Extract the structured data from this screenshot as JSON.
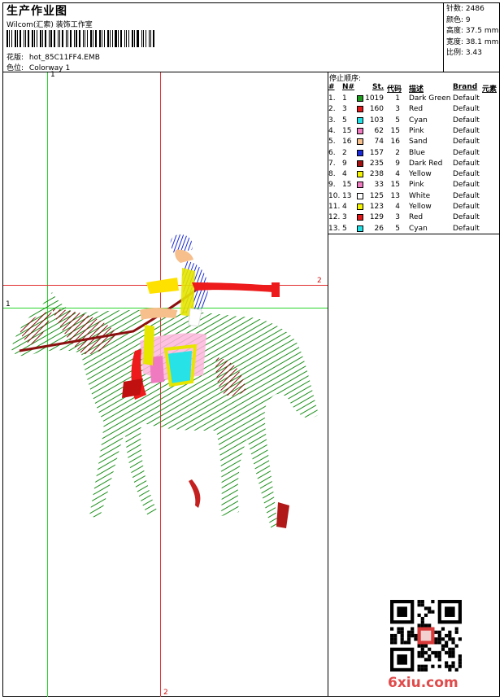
{
  "header": {
    "title": "生产作业图",
    "company": "Wilcom(汇索) 装饰工作室",
    "design_label": "花版:",
    "design_value": "hot_85C11FF4.EMB",
    "colorway_label": "色位:",
    "colorway_value": "Colorway 1"
  },
  "stats": [
    {
      "label": "针数:",
      "value": "2486"
    },
    {
      "label": "颜色:",
      "value": "9"
    },
    {
      "label": "高度:",
      "value": "37.5 mm"
    },
    {
      "label": "宽度:",
      "value": "38.1 mm"
    },
    {
      "label": "比例:",
      "value": "3.43"
    }
  ],
  "stop_sequence": {
    "title": "停止顺序:",
    "headers": {
      "no": "#",
      "n": "N#",
      "st": "St.",
      "code": "代码",
      "desc": "描述",
      "brand": "Brand",
      "element": "元素"
    },
    "rows": [
      {
        "no": "1.",
        "n": "1",
        "color": "#1e9a1e",
        "st": "1019",
        "code": "1",
        "desc": "Dark Green",
        "brand": "Default"
      },
      {
        "no": "2.",
        "n": "3",
        "color": "#e01a1a",
        "st": "160",
        "code": "3",
        "desc": "Red",
        "brand": "Default"
      },
      {
        "no": "3.",
        "n": "5",
        "color": "#22e0e6",
        "st": "103",
        "code": "5",
        "desc": "Cyan",
        "brand": "Default"
      },
      {
        "no": "4.",
        "n": "15",
        "color": "#f07ac0",
        "st": "62",
        "code": "15",
        "desc": "Pink",
        "brand": "Default"
      },
      {
        "no": "5.",
        "n": "16",
        "color": "#f6bf8c",
        "st": "74",
        "code": "16",
        "desc": "Sand",
        "brand": "Default"
      },
      {
        "no": "6.",
        "n": "2",
        "color": "#1a2ad6",
        "st": "157",
        "code": "2",
        "desc": "Blue",
        "brand": "Default"
      },
      {
        "no": "7.",
        "n": "9",
        "color": "#a01010",
        "st": "235",
        "code": "9",
        "desc": "Dark Red",
        "brand": "Default"
      },
      {
        "no": "8.",
        "n": "4",
        "color": "#f4f400",
        "st": "238",
        "code": "4",
        "desc": "Yellow",
        "brand": "Default"
      },
      {
        "no": "9.",
        "n": "15",
        "color": "#f07ac0",
        "st": "33",
        "code": "15",
        "desc": "Pink",
        "brand": "Default"
      },
      {
        "no": "10.",
        "n": "13",
        "color": "#ffffff",
        "st": "125",
        "code": "13",
        "desc": "White",
        "brand": "Default"
      },
      {
        "no": "11.",
        "n": "4",
        "color": "#f4f400",
        "st": "123",
        "code": "4",
        "desc": "Yellow",
        "brand": "Default"
      },
      {
        "no": "12.",
        "n": "3",
        "color": "#e01a1a",
        "st": "129",
        "code": "3",
        "desc": "Red",
        "brand": "Default"
      },
      {
        "no": "13.",
        "n": "5",
        "color": "#22e0e6",
        "st": "26",
        "code": "5",
        "desc": "Cyan",
        "brand": "Default"
      }
    ]
  },
  "guides": {
    "green_v": "1",
    "green_h": "1",
    "red_h": "2",
    "red_v": "2"
  },
  "watermark": "6xiu.com"
}
